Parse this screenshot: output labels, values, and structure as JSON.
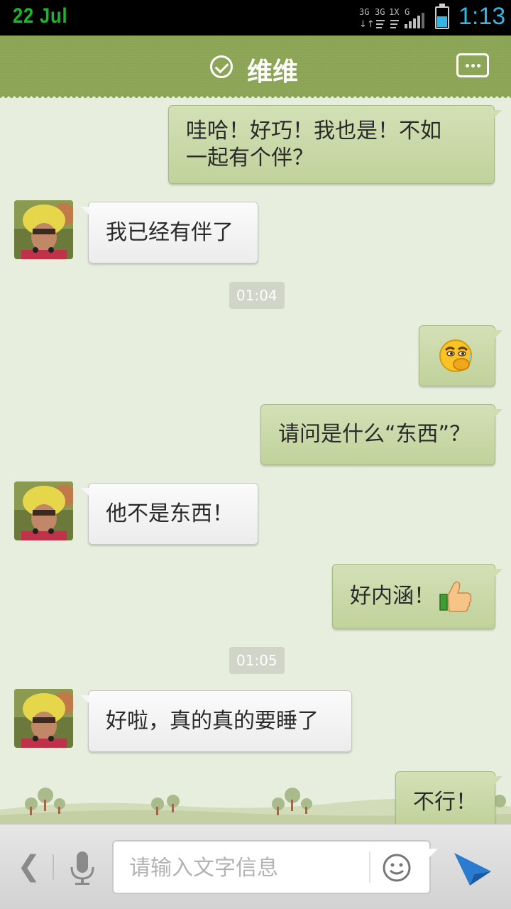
{
  "status_bar": {
    "date": "22  Jul",
    "network": "3G 3G 1X G",
    "time": "1:13",
    "battery_level": 0.55
  },
  "header": {
    "contact_name": "维维",
    "verified_icon": "check-circle-icon",
    "menu_icon": "chat-menu-icon"
  },
  "messages": [
    {
      "side": "out",
      "text": "哇哈！好巧！我也是！不如\n一起有个伴？"
    },
    {
      "side": "in",
      "text": "我已经有伴了"
    },
    {
      "type": "timestamp",
      "text": "01:04"
    },
    {
      "side": "out",
      "emoji": "thinking-emoji"
    },
    {
      "side": "out",
      "text": "请问是什么“东西”？"
    },
    {
      "side": "in",
      "text": "他不是东西！"
    },
    {
      "side": "out",
      "text": "好内涵！",
      "emoji": "thumbs-up-emoji"
    },
    {
      "type": "timestamp",
      "text": "01:05"
    },
    {
      "side": "in",
      "text": "好啦，真的真的要睡了"
    },
    {
      "side": "out",
      "text": "不行！"
    }
  ],
  "input_bar": {
    "placeholder": "请输入文字信息",
    "back_icon": "chevron-left-icon",
    "voice_icon": "microphone-icon",
    "emoji_icon": "smiley-icon",
    "send_icon": "send-icon"
  },
  "colors": {
    "header": "#8ba455",
    "outgoing_bubble": "#c9d8a8",
    "incoming_bubble": "#f5f5f5",
    "background": "#e8eedd",
    "status_time": "#33b5e5",
    "status_date": "#19b82a"
  }
}
